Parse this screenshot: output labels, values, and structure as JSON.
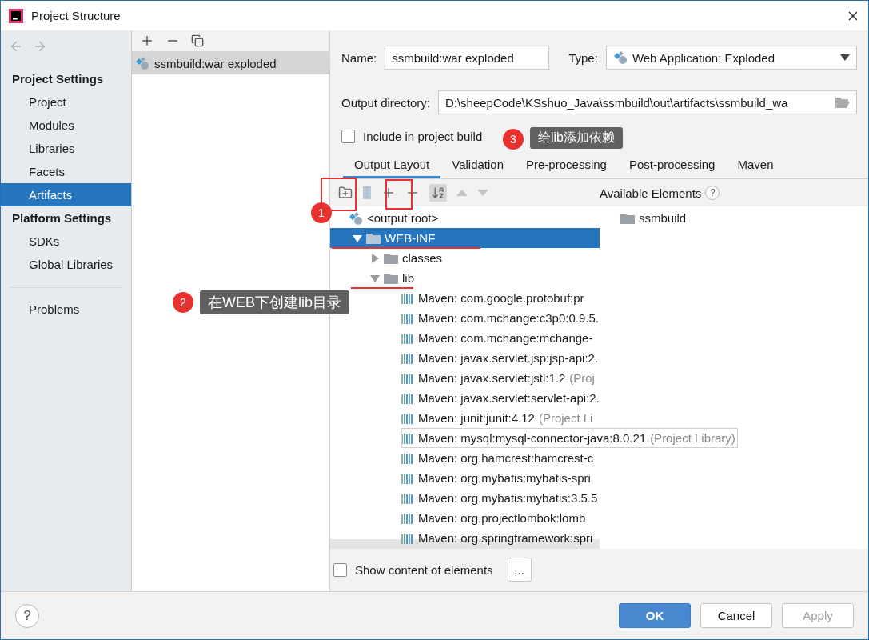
{
  "window": {
    "title": "Project Structure"
  },
  "sidebar": {
    "sections": [
      {
        "title": "Project Settings",
        "items": [
          {
            "label": "Project",
            "selected": false
          },
          {
            "label": "Modules",
            "selected": false
          },
          {
            "label": "Libraries",
            "selected": false
          },
          {
            "label": "Facets",
            "selected": false
          },
          {
            "label": "Artifacts",
            "selected": true
          }
        ]
      },
      {
        "title": "Platform Settings",
        "items": [
          {
            "label": "SDKs",
            "selected": false
          },
          {
            "label": "Global Libraries",
            "selected": false
          }
        ]
      },
      {
        "items": [
          {
            "label": "Problems",
            "selected": false
          }
        ]
      }
    ]
  },
  "artifacts": [
    {
      "label": "ssmbuild:war exploded",
      "selected": true
    }
  ],
  "form": {
    "name_label": "Name:",
    "name_value": "ssmbuild:war exploded",
    "type_label": "Type:",
    "type_value": "Web Application: Exploded",
    "output_label": "Output directory:",
    "output_value": "D:\\sheepCode\\KSshuo_Java\\ssmbuild\\out\\artifacts\\ssmbuild_wa",
    "include_label": "Include in project build",
    "include_checked": false
  },
  "tabs": [
    {
      "label": "Output Layout",
      "selected": true
    },
    {
      "label": "Validation",
      "selected": false
    },
    {
      "label": "Pre-processing",
      "selected": false
    },
    {
      "label": "Post-processing",
      "selected": false
    },
    {
      "label": "Maven",
      "selected": false
    }
  ],
  "tree": [
    {
      "label": "<output root>",
      "kind": "root",
      "selected": false,
      "children": [
        {
          "label": "WEB-INF",
          "kind": "folder",
          "expanded": true,
          "selected": true,
          "children": [
            {
              "label": "classes",
              "kind": "folder",
              "expanded": false,
              "selected": false
            },
            {
              "label": "lib",
              "kind": "folder",
              "expanded": true,
              "selected": false,
              "children": [
                {
                  "label": "Maven: com.google.protobuf:pr",
                  "kind": "library",
                  "selected": false
                },
                {
                  "label": "Maven: com.mchange:c3p0:0.9.5.",
                  "kind": "library",
                  "selected": false
                },
                {
                  "label": "Maven: com.mchange:mchange-",
                  "kind": "library",
                  "selected": false
                },
                {
                  "label": "Maven: javax.servlet.jsp:jsp-api:2.",
                  "kind": "library",
                  "selected": false
                },
                {
                  "label": "Maven: javax.servlet:jstl:1.2",
                  "suffix": "(Proj",
                  "kind": "library",
                  "selected": false
                },
                {
                  "label": "Maven: javax.servlet:servlet-api:2.",
                  "kind": "library",
                  "selected": false
                },
                {
                  "label": "Maven: junit:junit:4.12",
                  "suffix": "(Project Li",
                  "kind": "library",
                  "selected": false
                },
                {
                  "label": "Maven: mysql:mysql-connector-java:8.0.21",
                  "suffix": "(Project Library)",
                  "kind": "library",
                  "hovered": true,
                  "selected": false
                },
                {
                  "label": "Maven: org.hamcrest:hamcrest-c",
                  "kind": "library",
                  "selected": false
                },
                {
                  "label": "Maven: org.mybatis:mybatis-spri",
                  "kind": "library",
                  "selected": false
                },
                {
                  "label": "Maven: org.mybatis:mybatis:3.5.5",
                  "kind": "library",
                  "selected": false
                },
                {
                  "label": "Maven: org.projectlombok:lomb",
                  "kind": "library",
                  "selected": false
                },
                {
                  "label": "Maven: org.springframework:spri",
                  "kind": "library",
                  "selected": false
                }
              ]
            }
          ]
        }
      ]
    }
  ],
  "available": {
    "title": "Available Elements",
    "help": "?",
    "items": [
      {
        "label": "ssmbuild"
      }
    ]
  },
  "show_content": {
    "label": "Show content of elements",
    "checked": false,
    "button": "..."
  },
  "footer": {
    "help": "?",
    "buttons": [
      {
        "label": "OK",
        "kind": "primary"
      },
      {
        "label": "Cancel",
        "kind": "normal"
      },
      {
        "label": "Apply",
        "kind": "disabled"
      }
    ]
  },
  "annotations": [
    {
      "kind": "badge",
      "number": "1"
    },
    {
      "kind": "callout",
      "number": "2",
      "text": "在WEB下创建lib目录"
    },
    {
      "kind": "callout",
      "number": "3",
      "text": "给lib添加依赖"
    }
  ]
}
